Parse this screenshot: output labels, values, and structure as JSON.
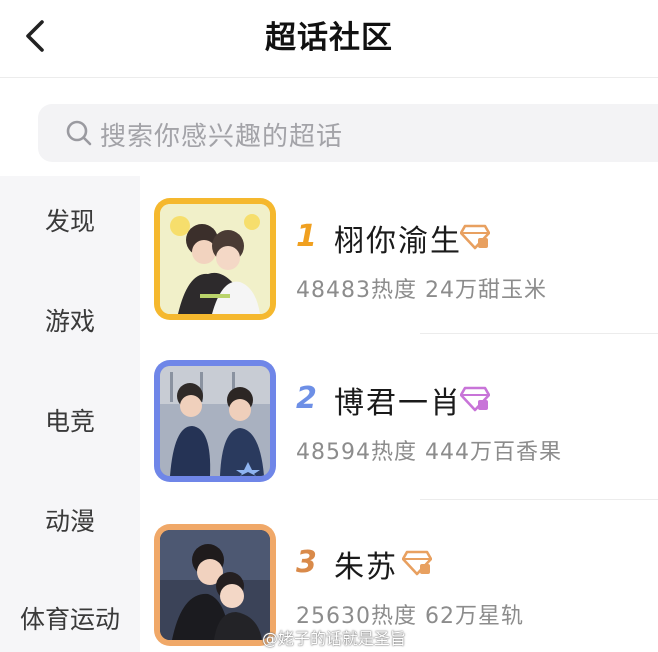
{
  "header": {
    "title": "超话社区",
    "back_icon": "chevron-left-icon"
  },
  "search": {
    "placeholder": "搜索你感兴趣的超话",
    "icon": "search-icon"
  },
  "sidebar": {
    "items": [
      {
        "label": "发现"
      },
      {
        "label": "游戏"
      },
      {
        "label": "电竞"
      },
      {
        "label": "动漫"
      },
      {
        "label": "体育运动"
      }
    ]
  },
  "list": {
    "items": [
      {
        "rank": "1",
        "name": "栩你渝生",
        "stats": "48483热度 24万甜玉米",
        "badge_color": "#e8a060",
        "frame_color": "#f5b82e",
        "rank_color": "#f0a020"
      },
      {
        "rank": "2",
        "name": "博君一肖",
        "stats": "48594热度 444万百香果",
        "badge_color": "#c874d8",
        "frame_color": "#6f86e8",
        "rank_color": "#6d8fe6"
      },
      {
        "rank": "3",
        "name": "朱苏",
        "stats": "25630热度 62万星轨",
        "badge_color": "#e8a060",
        "frame_color": "#f0a868",
        "rank_color": "#d98a4a"
      }
    ]
  },
  "watermark": "@姥子的话就是圣旨"
}
